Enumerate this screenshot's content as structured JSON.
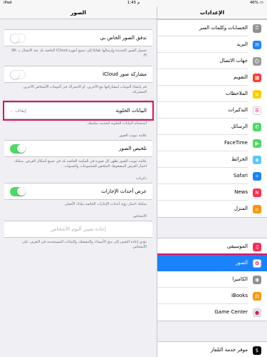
{
  "status": {
    "time": "1:45 م",
    "device": "iPad",
    "battery": "46%"
  },
  "master": {
    "title": "الإعدادات",
    "group1": [
      {
        "label": "الحسابات وكلمات السر",
        "icon": "key-icon",
        "color": "#8e8e93"
      },
      {
        "label": "البريد",
        "icon": "mail-icon",
        "color": "#1b82fb"
      },
      {
        "label": "جهات الاتصال",
        "icon": "contacts-icon",
        "color": "#9a9a9a"
      },
      {
        "label": "التقويم",
        "icon": "calendar-icon",
        "color": "#ff3b30"
      },
      {
        "label": "الملاحظات",
        "icon": "notes-icon",
        "color": "#ffcc00"
      },
      {
        "label": "التذكيرات",
        "icon": "reminders-icon",
        "color": "#ffffff"
      },
      {
        "label": "الرسائل",
        "icon": "messages-icon",
        "color": "#4cd964"
      },
      {
        "label": "FaceTime",
        "icon": "facetime-icon",
        "color": "#4cd964"
      },
      {
        "label": "الخرائط",
        "icon": "maps-icon",
        "color": "#5ac8fa"
      },
      {
        "label": "Safari",
        "icon": "safari-icon",
        "color": "#1b82fb"
      },
      {
        "label": "News",
        "icon": "news-icon",
        "color": "#ff2d55"
      },
      {
        "label": "المنزل",
        "icon": "home-icon",
        "color": "#ff9500"
      }
    ],
    "group2": [
      {
        "label": "الموسيقى",
        "icon": "music-icon",
        "color": "#ff2d55"
      },
      {
        "label": "الصور",
        "icon": "photos-icon",
        "color": "#ffffff",
        "selected": true
      },
      {
        "label": "الكاميرا",
        "icon": "camera-icon",
        "color": "#8e8e93"
      },
      {
        "label": "iBooks",
        "icon": "ibooks-icon",
        "color": "#ff9500"
      },
      {
        "label": "Game Center",
        "icon": "game-center-icon",
        "color": "#e5e5ea"
      }
    ],
    "group3": [
      {
        "label": "موفر خدمة التلفاز",
        "icon": "tv-provider-icon",
        "color": "#000000"
      }
    ]
  },
  "detail": {
    "title": "الصور",
    "photo_stream": {
      "label": "تدفق الصور الخاص بي",
      "on": false,
      "footer": "تحميل الصور الجديدة وإرسالها تلقائيًا إلى جميع أجهزة iCloud الخاصة بك عند الاتصال بـ Wi-Fi."
    },
    "icloud_sharing": {
      "label": "مشاركة صور iCloud",
      "on": false,
      "footer": "قم بإنشاء ألبومات لمشاركتها مع الآخرين، أو الاشتراك في ألبومات الأشخاص الآخرين المشتركة."
    },
    "cellular": {
      "label": "البيانات الخلوية",
      "value": "إيقاف",
      "footer": "استخدام البيانات الخلوية لتحديث مكتبتك."
    },
    "summary_header": "علامة تبويب الصور",
    "summarize": {
      "label": "تلخيص الصور",
      "on": true,
      "footer": "علامة تبويب الصور تظهر كل صورة في المكتبة الخاصة بك في جميع أشكال العرض. يمكنك اختيار العرض المضغوط، الملخص للمجموعات والسنوات."
    },
    "memories_header": "ذكريات",
    "holiday": {
      "label": "عرض أحداث الإجازات",
      "on": true,
      "footer": "يمكنك اختيار رؤية أحداث الإجازات الخاصة ببلدك الأصلي."
    },
    "people_header": "الأشخاص",
    "reset_people": {
      "label": "إعادة تعيين ألبوم الأشخاص",
      "footer": "تؤدي إعادة التعيين إلى منح الأسماء، والمفضلة، والبيانات المستخدمة في التعرف على الأشخاص."
    }
  }
}
